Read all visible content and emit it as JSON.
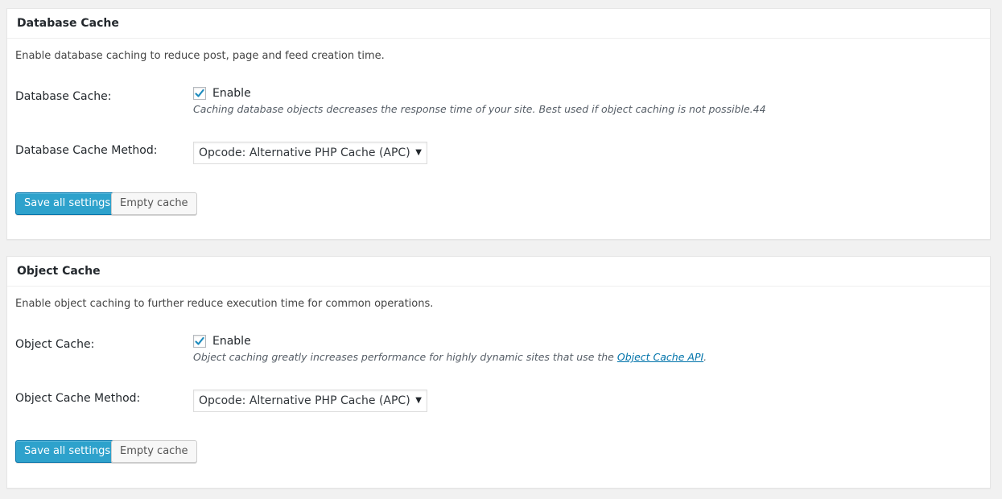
{
  "database_cache": {
    "title": "Database Cache",
    "description": "Enable database caching to reduce post, page and feed creation time.",
    "enable_label": "Database Cache:",
    "enable_checkbox_label": "Enable",
    "enable_checked": true,
    "enable_hint": "Caching database objects decreases the response time of your site. Best used if object caching is not possible.44",
    "method_label": "Database Cache Method:",
    "method_value": "Opcode: Alternative PHP Cache (APC)",
    "save_label": "Save all settings",
    "empty_label": "Empty cache"
  },
  "object_cache": {
    "title": "Object Cache",
    "description": "Enable object caching to further reduce execution time for common operations.",
    "enable_label": "Object Cache:",
    "enable_checkbox_label": "Enable",
    "enable_checked": true,
    "enable_hint_prefix": "Object caching greatly increases performance for highly dynamic sites that use the ",
    "enable_hint_link": "Object Cache API",
    "enable_hint_suffix": ".",
    "method_label": "Object Cache Method:",
    "method_value": "Opcode: Alternative PHP Cache (APC)",
    "save_label": "Save all settings",
    "empty_label": "Empty cache"
  },
  "icons": {
    "checkbox": "checkmark-icon",
    "select_arrow": "chevron-down-icon"
  },
  "colors": {
    "primary_button": "#2ea2cc",
    "link": "#0073aa",
    "checkmark": "#1e8cbe",
    "background": "#f1f1f1"
  }
}
